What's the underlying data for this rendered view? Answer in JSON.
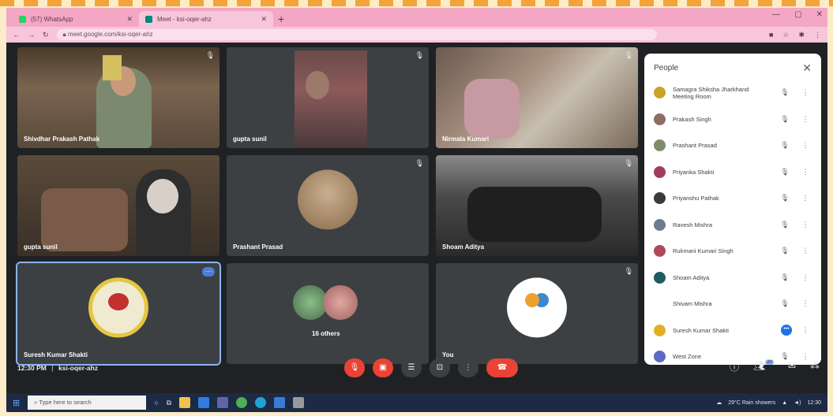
{
  "browser": {
    "tabs": [
      {
        "title": "(57) WhatsApp",
        "color": "#25d366"
      },
      {
        "title": "Meet - ksi-oqer-ahz",
        "color": "#00897b"
      }
    ],
    "new_tab_icon": "plus-icon",
    "url": "meet.google.com/ksi-oqer-ahz"
  },
  "meet": {
    "tiles": [
      {
        "name": "Shivdhar Prakash Pathak",
        "mic": "mic-off-icon"
      },
      {
        "name": "gupta sunil",
        "mic": "mic-off-icon"
      },
      {
        "name": "Nirmala Kumari",
        "mic": "mic-off-icon"
      },
      {
        "name": "gupta sunil",
        "mic": ""
      },
      {
        "name": "Prashant Prasad",
        "mic": "mic-off-icon"
      },
      {
        "name": "Shoam Aditya",
        "mic": "mic-off-icon"
      },
      {
        "name": "Suresh Kumar Shakti",
        "mic": ""
      },
      {
        "name": "16 others",
        "mic": ""
      },
      {
        "name": "You",
        "mic": "mic-off-icon"
      }
    ],
    "more_options": "⋯"
  },
  "people": {
    "title": "People",
    "close": "✕",
    "participants": [
      {
        "name": "Samagra Shiksha Jharkhand Meeting Room",
        "avatar_color": "#c9a227"
      },
      {
        "name": "Prakash Singh",
        "avatar_color": "#8d6e63"
      },
      {
        "name": "Prashant Prasad",
        "avatar_color": "#7e8c6a"
      },
      {
        "name": "Priyanka Shakti",
        "avatar_color": "#a33b5e"
      },
      {
        "name": "Priyanshu Pathak",
        "avatar_color": "#3a3a3a"
      },
      {
        "name": "Ravesh Mishra",
        "avatar_color": "#6b7b8c"
      },
      {
        "name": "Rukmani Kumari Singh",
        "avatar_color": "#b0485c"
      },
      {
        "name": "Shoam Aditya",
        "avatar_color": "#1e5e5e"
      },
      {
        "name": "Shivam Mishra",
        "avatar_color": "#ffffff"
      },
      {
        "name": "Suresh Kumar Shakti",
        "avatar_color": "#e0b020"
      },
      {
        "name": "West Zone",
        "avatar_color": "#5c6bc0"
      }
    ]
  },
  "controls": {
    "time": "12:30 PM",
    "separator": "|",
    "meeting_code": "ksi-oqer-ahz",
    "people_count": "20"
  },
  "taskbar": {
    "search_placeholder": "Type here to search",
    "weather": "29°C  Rain showers",
    "clock": "12:30"
  }
}
